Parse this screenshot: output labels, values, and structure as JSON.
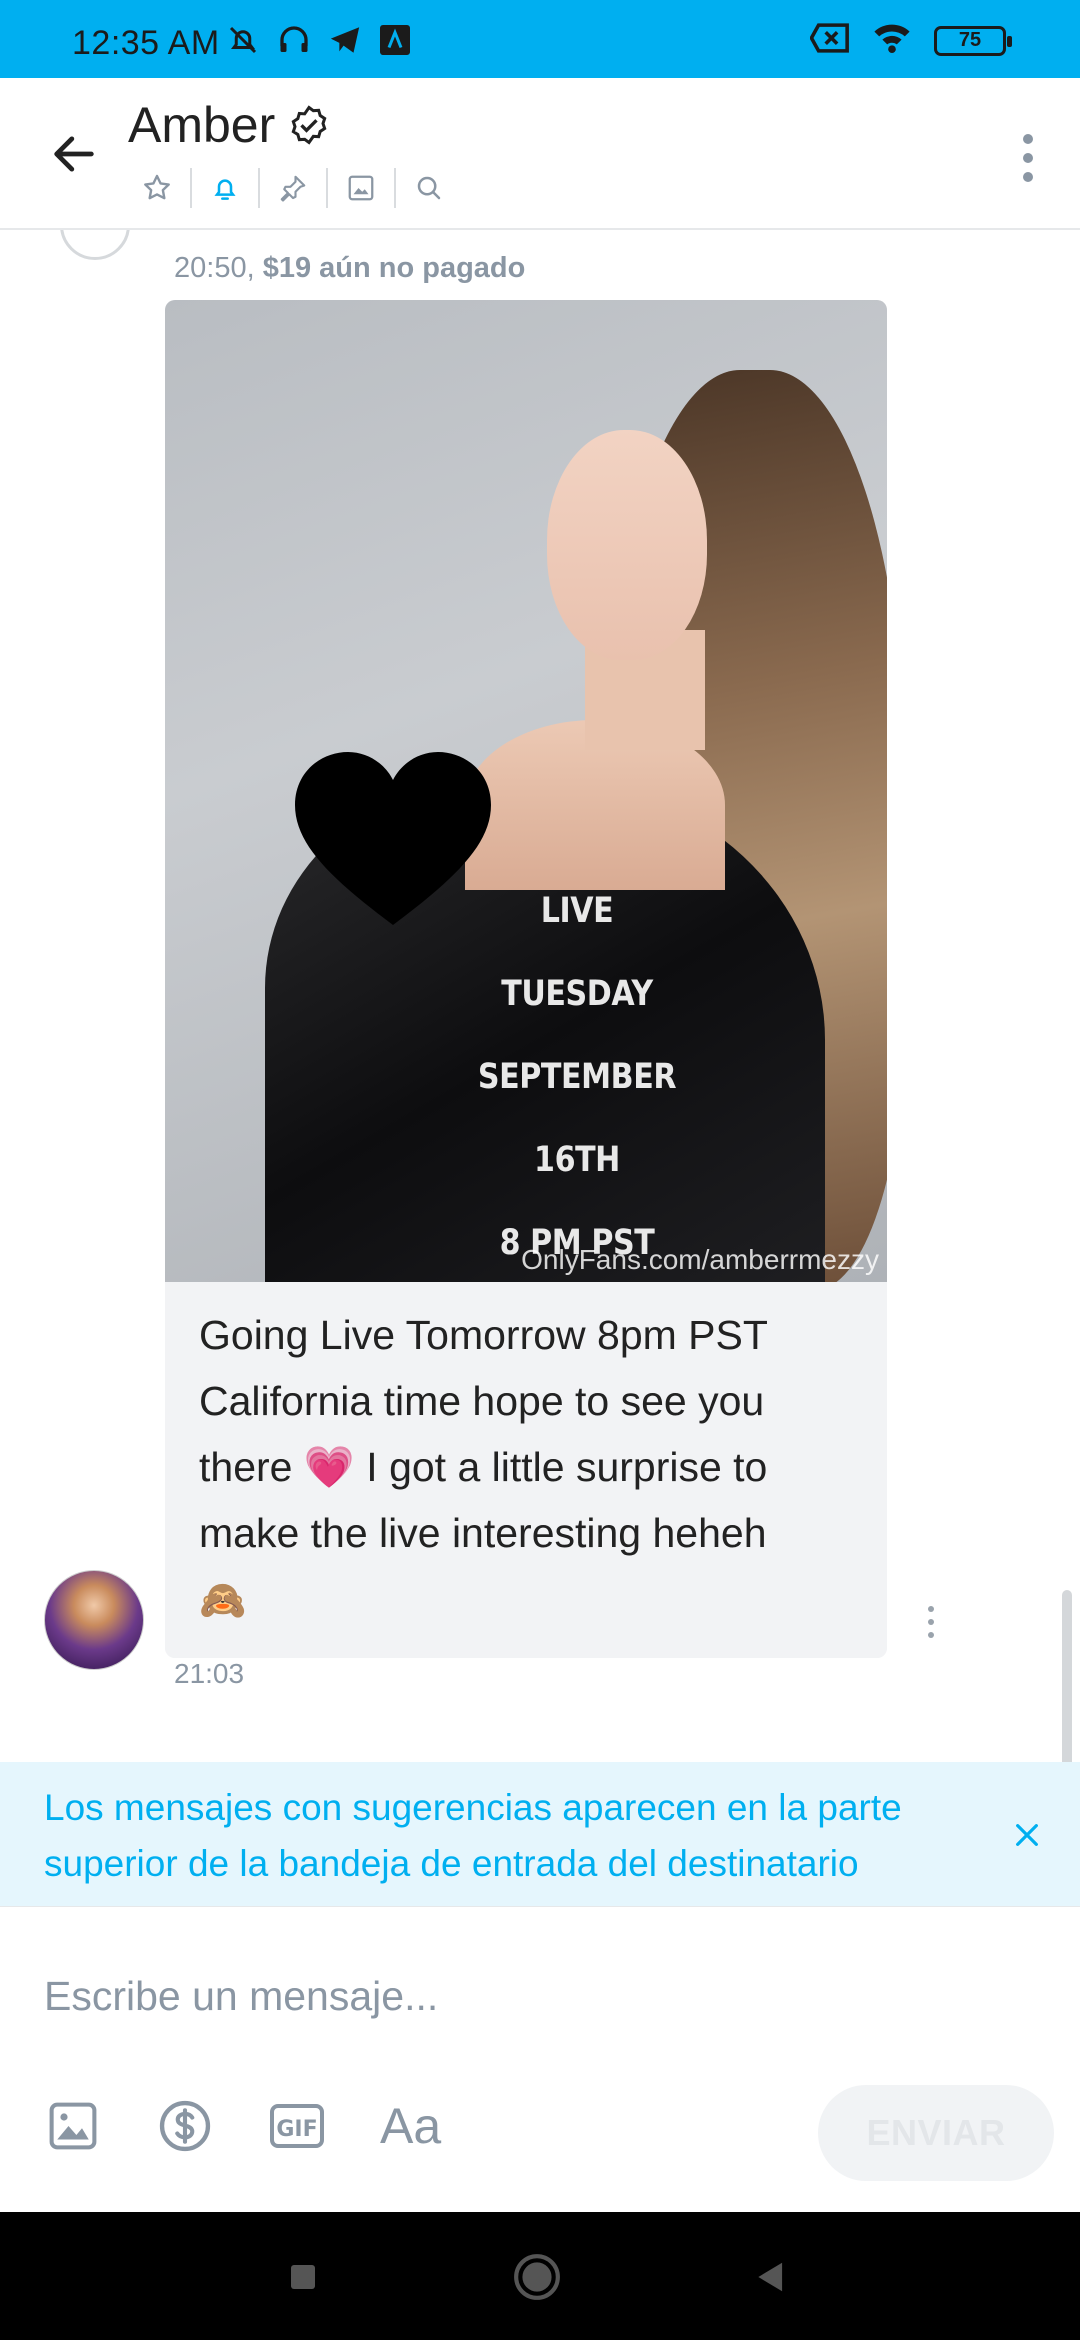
{
  "status_bar": {
    "time": "12:35 AM",
    "battery": "75"
  },
  "header": {
    "title": "Amber"
  },
  "chat": {
    "top_meta_time": "20:50,",
    "top_meta_price": "$19 aún no pagado",
    "photo_overlay_lines": [
      "LIVE",
      "TUESDAY",
      "SEPTEMBER",
      "16TH",
      "8 PM PST"
    ],
    "watermark": "OnlyFans.com/amberrmezzy",
    "message_text": "Going Live Tomorrow 8pm PST California time hope to see you there 💗 I got a little surprise to make the live interesting heheh",
    "message_emoji": "🙈",
    "bottom_meta_time": "21:03"
  },
  "notice": {
    "text": "Los mensajes con sugerencias aparecen en la parte superior de la bandeja de entrada del destinatario"
  },
  "composer": {
    "placeholder": "Escribe un mensaje...",
    "font_button": "Aa",
    "send_label": "ENVIAR"
  },
  "colors": {
    "accent": "#00aff0",
    "muted": "#8a96a3",
    "bubble": "#f2f3f5",
    "notice_bg": "#e5f6fd"
  }
}
